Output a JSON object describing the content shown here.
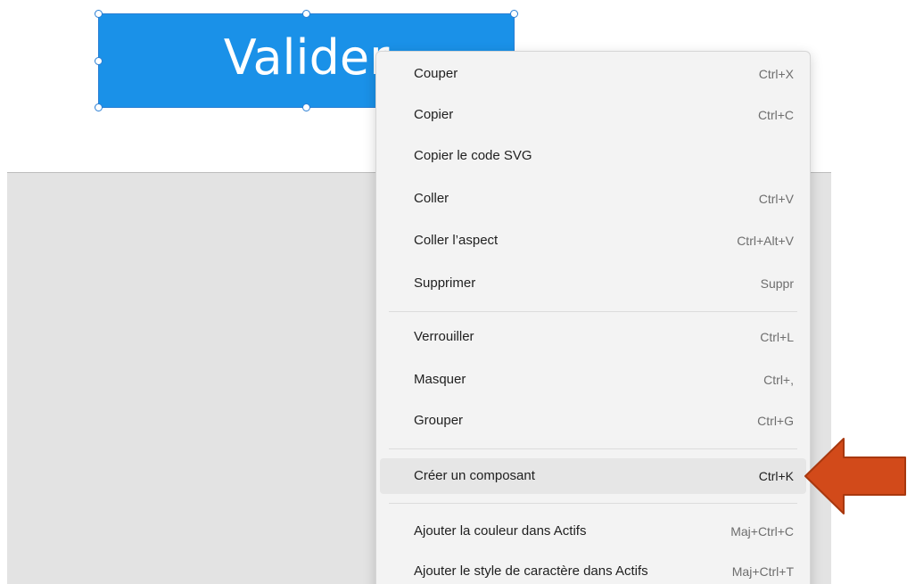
{
  "canvas": {
    "element": {
      "label": "Valider"
    }
  },
  "context_menu": {
    "items": [
      {
        "label": "Couper",
        "shortcut": "Ctrl+X"
      },
      {
        "label": "Copier",
        "shortcut": "Ctrl+C"
      },
      {
        "label": "Copier le code SVG",
        "shortcut": ""
      },
      {
        "label": "Coller",
        "shortcut": "Ctrl+V"
      },
      {
        "label": "Coller l’aspect",
        "shortcut": "Ctrl+Alt+V"
      },
      {
        "label": "Supprimer",
        "shortcut": "Suppr"
      },
      {
        "label": "Verrouiller",
        "shortcut": "Ctrl+L"
      },
      {
        "label": "Masquer",
        "shortcut": "Ctrl+,"
      },
      {
        "label": "Grouper",
        "shortcut": "Ctrl+G"
      },
      {
        "label": "Créer un composant",
        "shortcut": "Ctrl+K",
        "highlighted": true
      },
      {
        "label": "Ajouter la couleur dans Actifs",
        "shortcut": "Maj+Ctrl+C"
      },
      {
        "label": "Ajouter le style de caractère dans Actifs",
        "shortcut": "Maj+Ctrl+T"
      }
    ]
  },
  "colors": {
    "element_fill": "#1a91e8",
    "selection": "#2a7fd4",
    "menu_background": "#f3f3f3",
    "menu_highlight": "#e6e6e6",
    "callout_arrow": "#d24a1a",
    "artboard": "#e3e3e3"
  },
  "icons": {
    "callout": "left-arrow-icon"
  }
}
